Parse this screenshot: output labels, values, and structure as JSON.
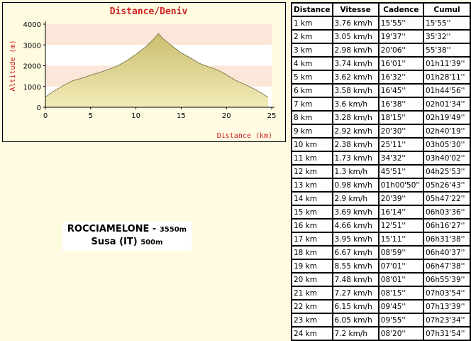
{
  "chart_data": {
    "type": "area",
    "title": "Distance/Deniv",
    "xlabel": "Distance (km)",
    "ylabel": "Altitude (m)",
    "xlim": [
      0,
      25
    ],
    "ylim": [
      0,
      4000
    ],
    "xticks": [
      0,
      5,
      10,
      15,
      20,
      25
    ],
    "yticks": [
      0,
      1000,
      2000,
      3000,
      4000
    ],
    "grid": "horizontal bands",
    "x": [
      0,
      1,
      2,
      3,
      4,
      5,
      6,
      7,
      8,
      9,
      10,
      11,
      12,
      12.5,
      13,
      14,
      15,
      16,
      17,
      18,
      19,
      20,
      21,
      22,
      23,
      24,
      24.6
    ],
    "y": [
      500,
      800,
      1050,
      1280,
      1400,
      1550,
      1680,
      1820,
      2000,
      2250,
      2550,
      2880,
      3300,
      3550,
      3300,
      2950,
      2620,
      2380,
      2120,
      1950,
      1800,
      1570,
      1300,
      1100,
      900,
      650,
      480
    ]
  },
  "colors": {
    "background": "#FFFBE1",
    "title": "#CC2222",
    "axis_label": "#CC2222",
    "area_fill_top": "#C9BE6E",
    "area_fill_bottom": "#F2EBB8",
    "band_light": "#FFFFFF",
    "band_tint": "#FBE7DA"
  },
  "caption": {
    "line1_main": "ROCCIAMELONE - ",
    "line1_small": "3550m",
    "line2_main": "Susa (IT) ",
    "line2_small": "500m"
  },
  "table": {
    "headers": [
      "Distance",
      "Vitesse",
      "Cadence",
      "Cumul"
    ],
    "rows": [
      [
        "1 km",
        "3.76 km/h",
        "15'55''",
        "15'55''"
      ],
      [
        "2 km",
        "3.05 km/h",
        "19'37''",
        "35'32''"
      ],
      [
        "3 km",
        "2.98 km/h",
        "20'06''",
        "55'38''"
      ],
      [
        "4 km",
        "3.74 km/h",
        "16'01''",
        "01h11'39''"
      ],
      [
        "5 km",
        "3.62 km/h",
        "16'32''",
        "01h28'11''"
      ],
      [
        "6 km",
        "3.58 km/h",
        "16'45''",
        "01h44'56''"
      ],
      [
        "7 km",
        "3.6 km/h",
        "16'38''",
        "02h01'34''"
      ],
      [
        "8 km",
        "3.28 km/h",
        "18'15''",
        "02h19'49''"
      ],
      [
        "9 km",
        "2.92 km/h",
        "20'30''",
        "02h40'19''"
      ],
      [
        "10 km",
        "2.38 km/h",
        "25'11''",
        "03h05'30''"
      ],
      [
        "11 km",
        "1.73 km/h",
        "34'32''",
        "03h40'02''"
      ],
      [
        "12 km",
        "1.3 km/h",
        "45'51''",
        "04h25'53''"
      ],
      [
        "13 km",
        "0.98 km/h",
        "01h00'50''",
        "05h26'43''"
      ],
      [
        "14 km",
        "2.9 km/h",
        "20'39''",
        "05h47'22''"
      ],
      [
        "15 km",
        "3.69 km/h",
        "16'14''",
        "06h03'36''"
      ],
      [
        "16 km",
        "4.66 km/h",
        "12'51''",
        "06h16'27''"
      ],
      [
        "17 km",
        "3.95 km/h",
        "15'11''",
        "06h31'38''"
      ],
      [
        "18 km",
        "6.67 km/h",
        "08'59''",
        "06h40'37''"
      ],
      [
        "19 km",
        "8.55 km/h",
        "07'01''",
        "06h47'38''"
      ],
      [
        "20 km",
        "7.48 km/h",
        "08'01''",
        "06h55'39''"
      ],
      [
        "21 km",
        "7.27 km/h",
        "08'15''",
        "07h03'54''"
      ],
      [
        "22 km",
        "6.15 km/h",
        "09'45''",
        "07h13'39''"
      ],
      [
        "23 km",
        "6.05 km/h",
        "09'55''",
        "07h23'34''"
      ],
      [
        "24 km",
        "7.2 km/h",
        "08'20''",
        "07h31'54''"
      ]
    ]
  }
}
